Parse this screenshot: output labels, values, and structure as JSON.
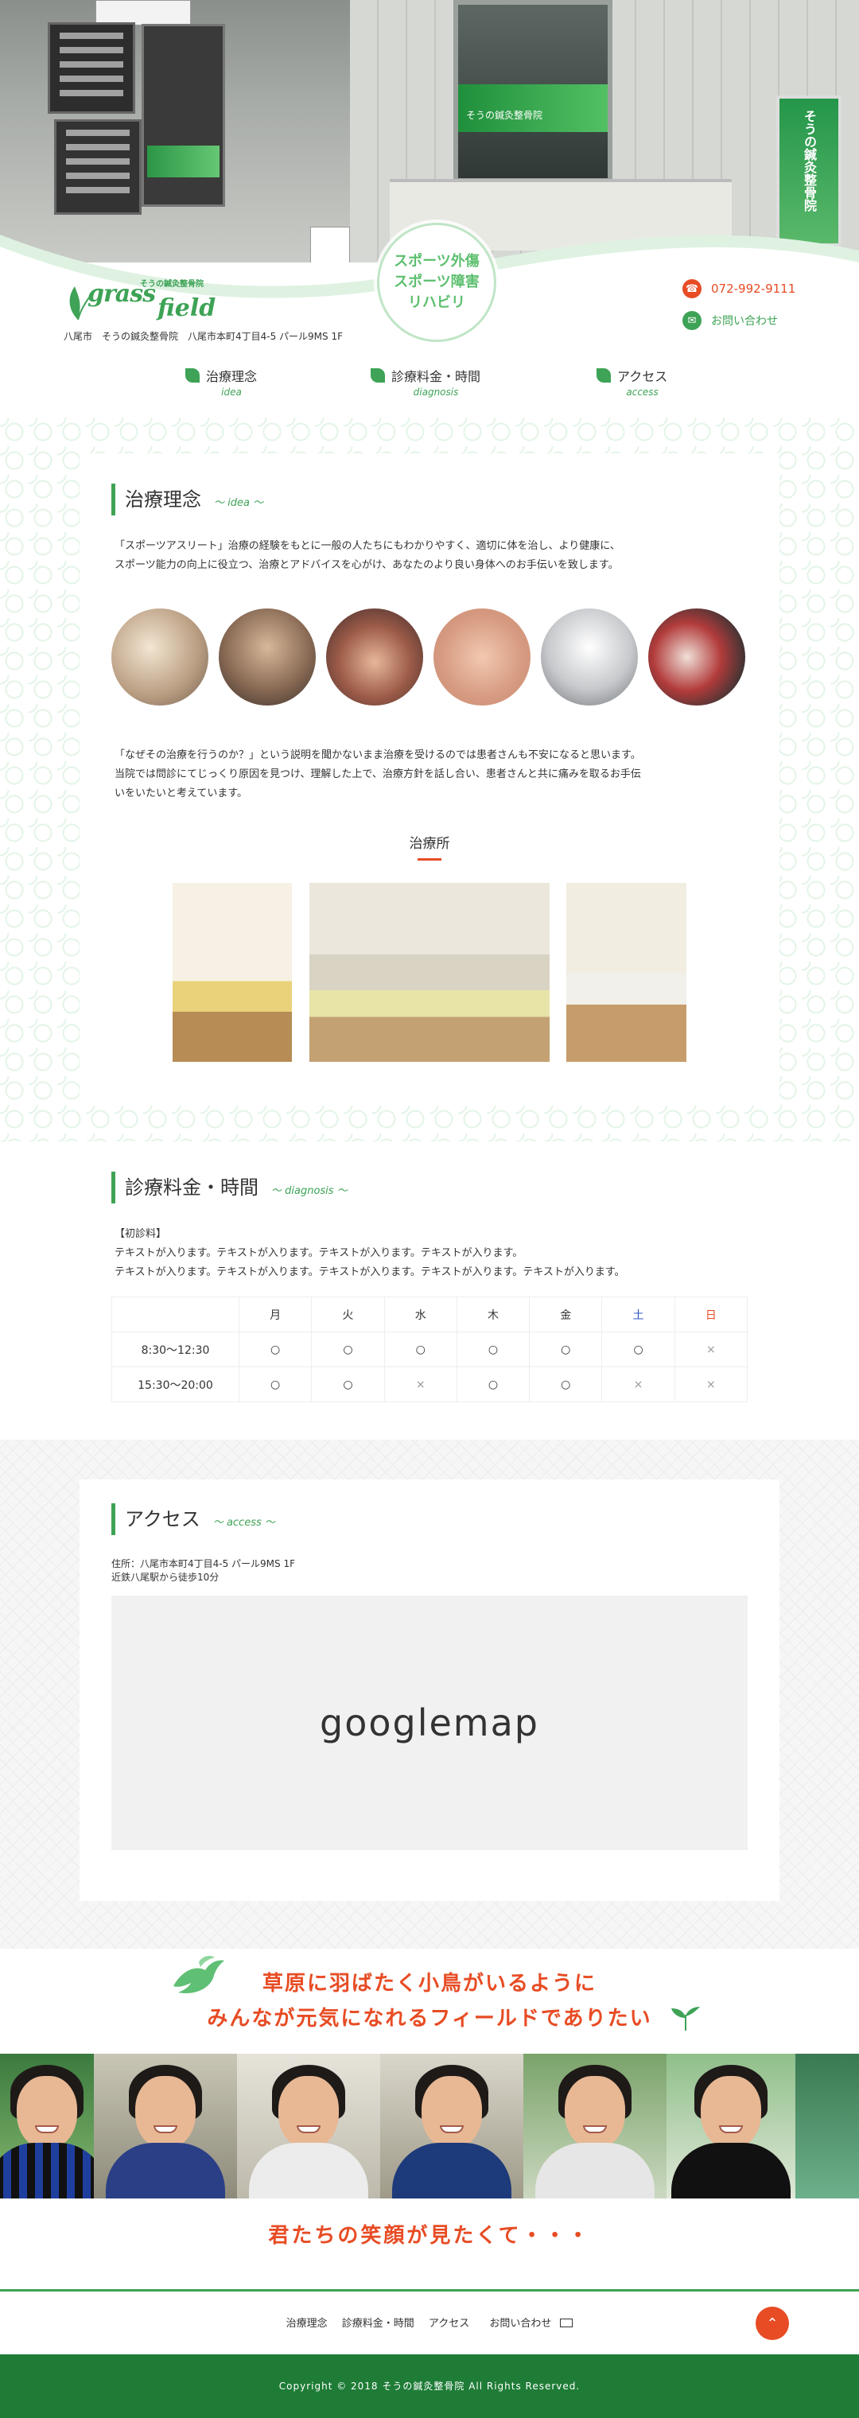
{
  "hero": {
    "badge_lines": [
      "スポーツ外傷",
      "スポーツ障害",
      "リハビリ"
    ],
    "door_sign": "そうの鍼灸整骨院",
    "stand_sign": "そうの鍼灸整骨院"
  },
  "header": {
    "logo_en": "grass",
    "logo_en2": "field",
    "logo_jp": "そうの鍼灸整骨院",
    "address": "八尾市　そうの鍼灸整骨院　八尾市本町4丁目4-5 パール9MS 1F",
    "tel": "072-992-9111",
    "contact_label": "お問い合わせ"
  },
  "nav": [
    {
      "label": "治療理念",
      "sub": "idea"
    },
    {
      "label": "診療料金・時間",
      "sub": "diagnosis"
    },
    {
      "label": "アクセス",
      "sub": "access"
    }
  ],
  "philosophy": {
    "title": "治療理念",
    "title_en": "～ idea ～",
    "para1_l1": "「スポーツアスリート」治療の経験をもとに一般の人たちにもわかりやすく、適切に体を治し、より健康に、",
    "para1_l2": "スポーツ能力の向上に役立つ、治療とアドバイスを心がけ、あなたのより良い身体へのお手伝いを致します。",
    "para2_l1": "「なぜその治療を行うのか？」という説明を聞かないまま治療を受けるのでは患者さんも不安になると思います。",
    "para2_l2": "当院では問診にてじっくり原因を見つけ、理解した上で、治療方針を話し合い、患者さんと共に痛みを取るお手伝",
    "para2_l3": "いをいたいと考えています。",
    "clinic_title": "治療所"
  },
  "fees": {
    "title": "診療料金・時間",
    "title_en": "～ diagnosis ～",
    "label": "【初診料】",
    "text_l1": "テキストが入ります。テキストが入ります。テキストが入ります。テキストが入ります。",
    "text_l2": "テキストが入ります。テキストが入ります。テキストが入ります。テキストが入ります。テキストが入ります。",
    "days": [
      "月",
      "火",
      "水",
      "木",
      "金",
      "土",
      "日"
    ],
    "rows": [
      {
        "time": "8:30〜12:30",
        "marks": [
          "○",
          "○",
          "○",
          "○",
          "○",
          "○",
          "×"
        ]
      },
      {
        "time": "15:30〜20:00",
        "marks": [
          "○",
          "○",
          "×",
          "○",
          "○",
          "×",
          "×"
        ]
      }
    ]
  },
  "access": {
    "title": "アクセス",
    "title_en": "～ access ～",
    "addr_l1": "住所：八尾市本町4丁目4-5 パール9MS 1F",
    "addr_l2": "近鉄八尾駅から徒歩10分",
    "map_label": "googlemap"
  },
  "slogan": {
    "line1": "草原に羽ばたく小鳥がいるように",
    "line2": "みんなが元気になれるフィールドでありたい",
    "smile": "君たちの笑顔が見たくて・・・"
  },
  "footer": {
    "links": [
      "治療理念",
      "診療料金・時間",
      "アクセス",
      "お問い合わせ"
    ],
    "copyright": "Copyright © 2018 そうの鍼灸整骨院 All Rights Reserved."
  },
  "colors": {
    "green": "#3ea356",
    "accent": "#e74c24",
    "footer": "#1e7c36"
  }
}
